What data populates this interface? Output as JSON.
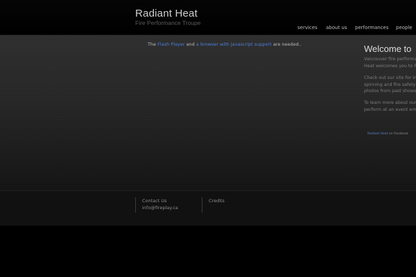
{
  "header": {
    "title": "Radiant Heat",
    "subtitle": "Fire Performance Troupe"
  },
  "nav": {
    "items": [
      "services",
      "about us",
      "performances",
      "people"
    ]
  },
  "main": {
    "flash_notice": {
      "prefix": "The",
      "link1": "Flash Player",
      "middle": "and",
      "link2": "a browser with Javascript support",
      "suffix": "are needed.."
    }
  },
  "sidebar": {
    "welcome_title": "Welcome to",
    "para1": [
      "Vancouver fire performa",
      "Heat welcomes you to F"
    ],
    "para2": [
      "Check out our site for in",
      "spinning and fire safety,",
      "photos from past shows"
    ],
    "para3": [
      "To learn more about our",
      "perform at an event ema"
    ],
    "facebook": {
      "link": "Radiant Heat",
      "suffix": "on Facebook"
    }
  },
  "footer": {
    "contact_heading": "Contact Us",
    "contact_email": "info@fireplay.ca",
    "credits_heading": "Credits"
  },
  "colors": {
    "link": "#4f7fd6",
    "background": "#000000",
    "panel": "#2a2a2a"
  }
}
